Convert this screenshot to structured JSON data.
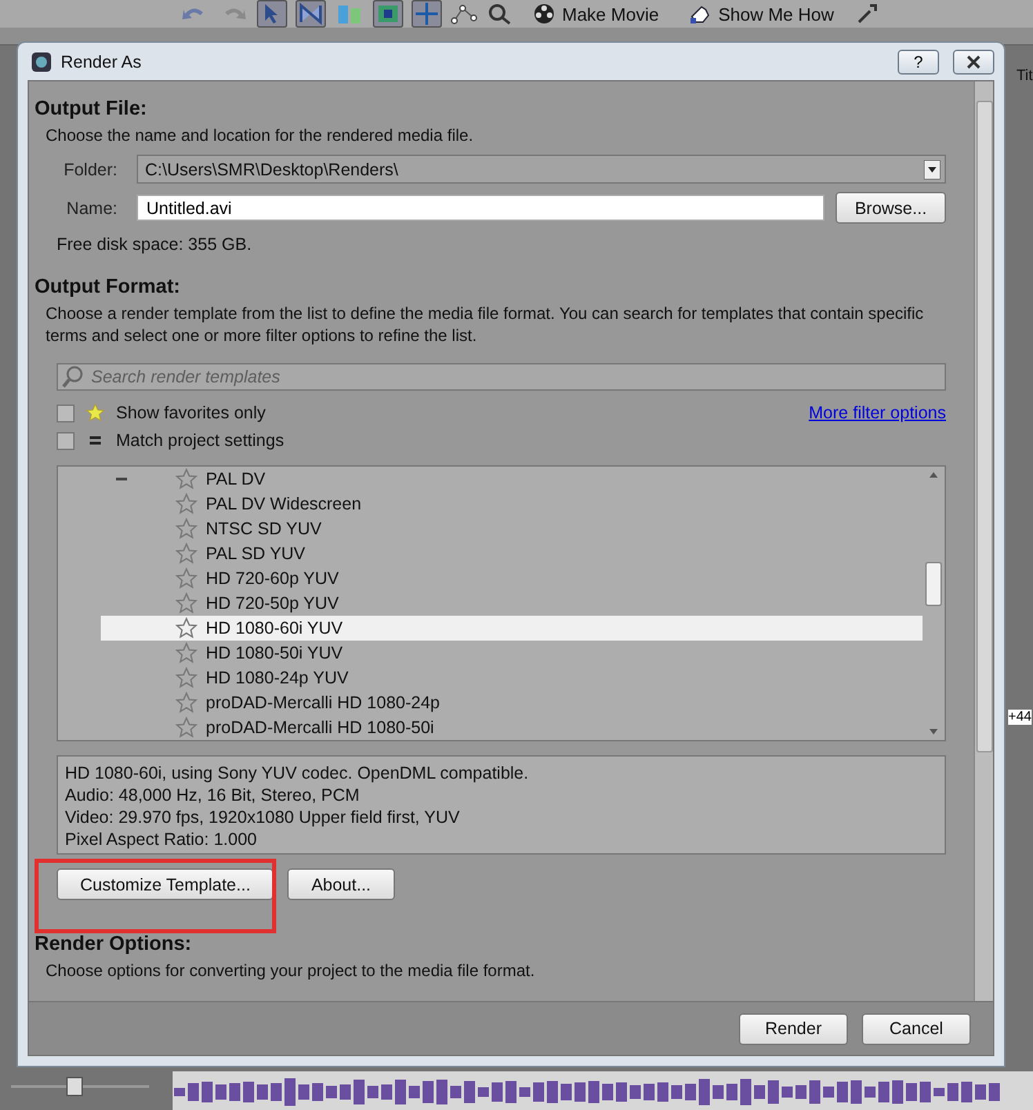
{
  "app_toolbar": {
    "buttons": [
      {
        "label": "Make Movie",
        "kind": "movie"
      },
      {
        "label": "Show Me How",
        "kind": "help"
      }
    ]
  },
  "timeline_slider": {
    "level": 0.45
  },
  "background_labels": {
    "top_right": "Tit",
    "timeline_right": "+44"
  },
  "dialog": {
    "title": "Render As",
    "help_button": "?",
    "output_file": {
      "heading": "Output File:",
      "description": "Choose the name and location for the rendered media file.",
      "folder": {
        "label": "Folder:",
        "value": "C:\\Users\\SMR\\Desktop\\Renders\\"
      },
      "name": {
        "label": "Name:",
        "value": "Untitled.avi"
      },
      "browse_button": "Browse...",
      "free_space": "Free disk space: 355 GB."
    },
    "output_format": {
      "heading": "Output Format:",
      "description": "Choose a render template from the list to define the media file format. You can search for templates that contain specific terms and select one or more filter options to refine the list.",
      "search": {
        "placeholder": "Search render templates"
      },
      "filters": [
        {
          "label": "Show favorites only",
          "kind": "favorites",
          "checked": false
        },
        {
          "label": "Match project settings",
          "kind": "match",
          "checked": false
        }
      ],
      "more_filter_link": "More filter options",
      "templates": [
        {
          "name": "PAL DV",
          "selected": false
        },
        {
          "name": "PAL DV Widescreen",
          "selected": false
        },
        {
          "name": "NTSC SD YUV",
          "selected": false
        },
        {
          "name": "PAL SD YUV",
          "selected": false
        },
        {
          "name": "HD 720-60p YUV",
          "selected": false
        },
        {
          "name": "HD 720-50p YUV",
          "selected": false
        },
        {
          "name": "HD 1080-60i YUV",
          "selected": true
        },
        {
          "name": "HD 1080-50i YUV",
          "selected": false
        },
        {
          "name": "HD 1080-24p YUV",
          "selected": false
        },
        {
          "name": "proDAD-Mercalli HD 1080-24p",
          "selected": false
        },
        {
          "name": "proDAD-Mercalli HD 1080-50i",
          "selected": false
        }
      ],
      "info_lines": [
        "HD 1080-60i, using Sony YUV codec. OpenDML compatible.",
        "Audio: 48,000 Hz, 16 Bit, Stereo, PCM",
        "Video: 29.970 fps, 1920x1080 Upper field first, YUV",
        "Pixel Aspect Ratio: 1.000"
      ],
      "buttons": [
        "Customize Template...",
        "About..."
      ]
    },
    "render_options": {
      "heading": "Render Options:",
      "description": "Choose options for converting your project to the media file format."
    },
    "footer_buttons": [
      "Render",
      "Cancel"
    ]
  }
}
